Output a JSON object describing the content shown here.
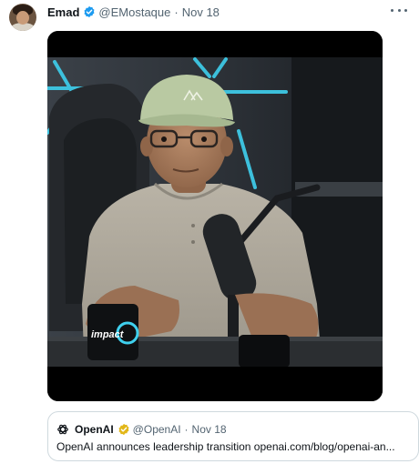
{
  "tweet": {
    "author_name": "Emad",
    "author_handle": "@EMostaque",
    "separator": "·",
    "date": "Nov 18",
    "more_icon": "more-horizontal-icon"
  },
  "media": {
    "mug_text": "impact"
  },
  "quoted_tweet": {
    "author_name": "OpenAI",
    "author_handle": "@OpenAI",
    "separator": "·",
    "date": "Nov 18",
    "text": "OpenAI announces leadership transition openai.com/blog/openai-an..."
  },
  "colors": {
    "verified_blue": "#1d9bf0",
    "verified_gold": "#e2b719",
    "text_primary": "#0f1419",
    "text_secondary": "#536471",
    "border": "#cfd9de",
    "neon_light": "#3fd0ee"
  }
}
